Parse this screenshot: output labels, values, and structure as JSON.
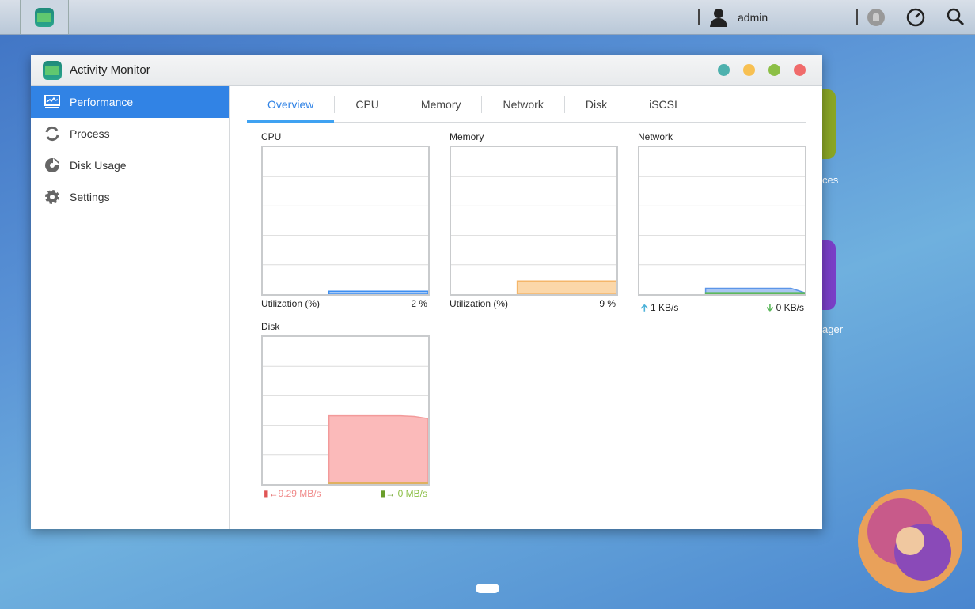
{
  "taskbar": {
    "user": "admin"
  },
  "desktop": {
    "icon1_label_partial": "ces",
    "icon2_label_partial": "ager"
  },
  "window": {
    "title": "Activity Monitor",
    "controls": [
      "info",
      "minimize",
      "maximize",
      "close"
    ],
    "control_colors": [
      "#4db1ae",
      "#f7c052",
      "#8cbf46",
      "#f06b6b"
    ]
  },
  "sidebar": {
    "items": [
      {
        "label": "Performance",
        "icon": "performance-icon",
        "active": true
      },
      {
        "label": "Process",
        "icon": "process-icon"
      },
      {
        "label": "Disk Usage",
        "icon": "disk-usage-icon"
      },
      {
        "label": "Settings",
        "icon": "gear-icon"
      }
    ]
  },
  "tabs": [
    {
      "label": "Overview",
      "active": true
    },
    {
      "label": "CPU"
    },
    {
      "label": "Memory"
    },
    {
      "label": "Network"
    },
    {
      "label": "Disk"
    },
    {
      "label": "iSCSI"
    }
  ],
  "panels": {
    "cpu": {
      "title": "CPU",
      "left": "Utilization (%)",
      "right": "2 %"
    },
    "memory": {
      "title": "Memory",
      "left": "Utilization (%)",
      "right": "9 %"
    },
    "network": {
      "title": "Network",
      "left": "1 KB/s",
      "right": "0 KB/s"
    },
    "disk": {
      "title": "Disk",
      "left": "9.29 MB/s",
      "right": "0 MB/s"
    }
  },
  "chart_data": [
    {
      "type": "area",
      "title": "CPU",
      "ylim": [
        0,
        100
      ],
      "x": [
        0,
        1,
        2,
        3,
        4,
        5,
        6,
        7,
        8,
        9,
        10,
        11,
        12
      ],
      "series": [
        {
          "name": "Utilization",
          "color": "#3d8ef0",
          "fill": "#a9cbf7",
          "values": [
            null,
            null,
            null,
            null,
            null,
            2,
            2,
            2,
            2,
            2,
            2,
            2,
            2
          ]
        }
      ]
    },
    {
      "type": "area",
      "title": "Memory",
      "ylim": [
        0,
        100
      ],
      "x": [
        0,
        1,
        2,
        3,
        4,
        5,
        6,
        7,
        8,
        9,
        10,
        11,
        12
      ],
      "series": [
        {
          "name": "Utilization",
          "color": "#f4b66a",
          "fill": "#fbd7a9",
          "values": [
            null,
            null,
            null,
            null,
            null,
            9,
            9,
            9,
            9,
            9,
            9,
            9,
            9
          ]
        }
      ]
    },
    {
      "type": "area",
      "title": "Network",
      "ylim": [
        0,
        100
      ],
      "x": [
        0,
        1,
        2,
        3,
        4,
        5,
        6,
        7,
        8,
        9,
        10,
        11,
        12
      ],
      "series": [
        {
          "name": "Upload",
          "color": "#5b95e8",
          "fill": "#a9c6f2",
          "values": [
            null,
            null,
            null,
            null,
            null,
            4,
            4,
            4,
            4,
            4,
            4,
            4,
            1
          ]
        },
        {
          "name": "Download",
          "color": "#5cb85c",
          "fill": "#5cb85c",
          "values": [
            null,
            null,
            null,
            null,
            null,
            1,
            1,
            1,
            1,
            1,
            1,
            1,
            1
          ]
        }
      ]
    },
    {
      "type": "area",
      "title": "Disk",
      "ylim": [
        0,
        20
      ],
      "x": [
        0,
        1,
        2,
        3,
        4,
        5,
        6,
        7,
        8,
        9,
        10,
        11,
        12
      ],
      "series": [
        {
          "name": "Read",
          "color": "#f29a9a",
          "fill": "#fbbaba",
          "values": [
            null,
            null,
            null,
            null,
            null,
            9.29,
            9.29,
            9.29,
            9.29,
            9.29,
            9.29,
            9.2,
            8.9
          ]
        },
        {
          "name": "Write",
          "color": "#e0b060",
          "fill": "#e0b060",
          "values": [
            null,
            null,
            null,
            null,
            null,
            0.1,
            0.1,
            0.1,
            0.1,
            0.1,
            0.1,
            0.1,
            0.1
          ]
        }
      ]
    }
  ]
}
